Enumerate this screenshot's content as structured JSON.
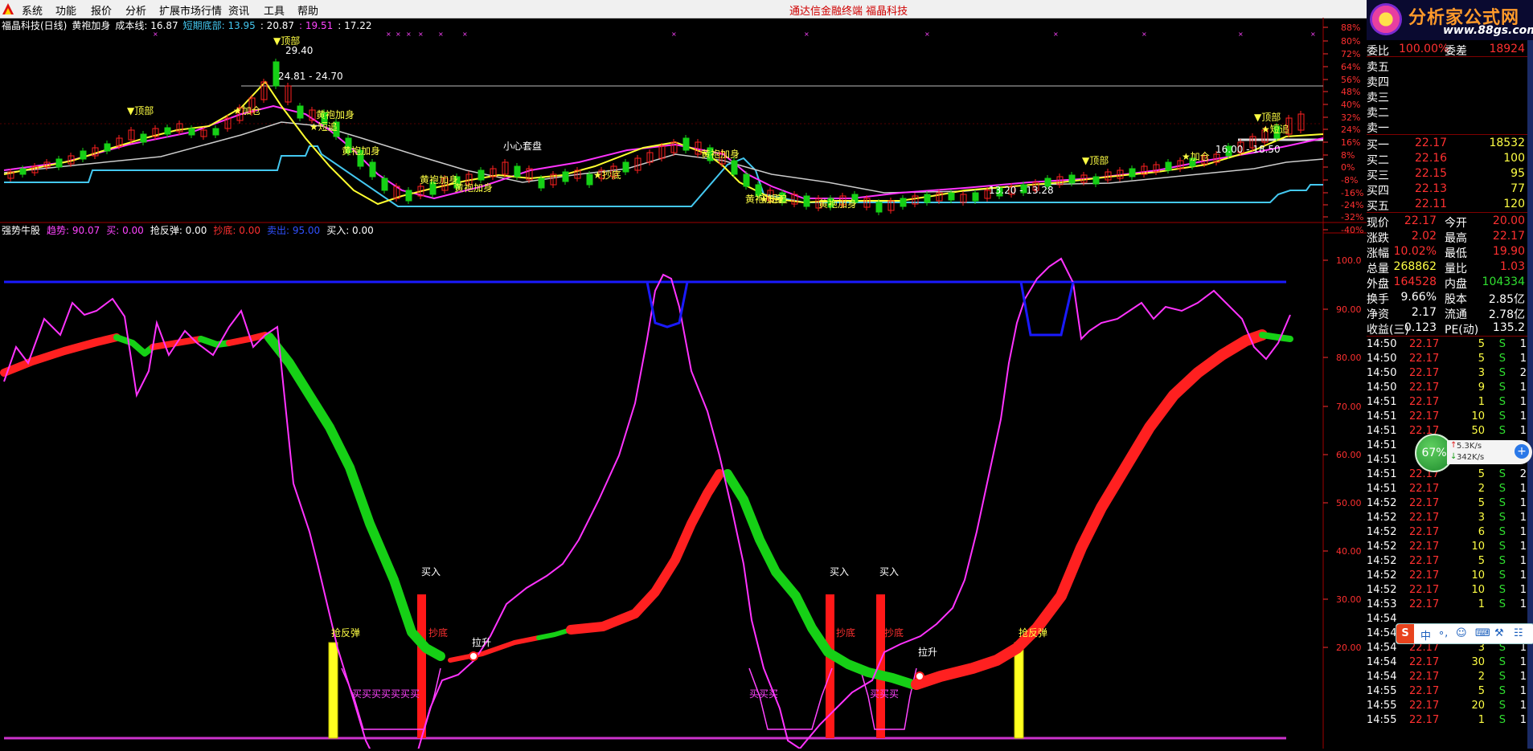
{
  "menu": {
    "items": [
      "系统",
      "功能",
      "报价",
      "分析",
      "扩展市场行情",
      "资讯",
      "工具",
      "帮助"
    ],
    "center_title": "通达信金融终端   福晶科技"
  },
  "top_chart": {
    "title_parts": [
      {
        "text": "福晶科技(日线)",
        "color": "#ffffff"
      },
      {
        "text": "黄袍加身",
        "color": "#ffffff"
      },
      {
        "text": "成本线: 16.87",
        "color": "#ffffff"
      },
      {
        "text": "短期底部: 13.95",
        "color": "#44c8f0"
      },
      {
        "text": ": 20.87",
        "color": "#ffffff"
      },
      {
        "text": ": 19.51",
        "color": "#ff44ff"
      },
      {
        "text": ": 17.22",
        "color": "#ffffff"
      }
    ],
    "y_labels": [
      "88%",
      "80%",
      "72%",
      "64%",
      "56%",
      "48%",
      "40%",
      "32%",
      "24%",
      "16%",
      "8%",
      "0%",
      "-8%",
      "-16%",
      "-24%",
      "-32%",
      "-40%"
    ],
    "annotations": [
      {
        "text": "▼顶部",
        "color": "#ffff44"
      },
      {
        "text": "29.40",
        "color": "#ffffff"
      },
      {
        "text": "24.81 - 24.70",
        "color": "#ffffff"
      },
      {
        "text": "▼顶部",
        "color": "#ffff44"
      },
      {
        "text": "★加仓",
        "color": "#ffff44"
      },
      {
        "text": "黄袍加身",
        "color": "#ffff44"
      },
      {
        "text": "★短追",
        "color": "#ffff44"
      },
      {
        "text": "黄袍加身",
        "color": "#ffff44"
      },
      {
        "text": "小心套盘",
        "color": "#ffffff"
      },
      {
        "text": "黄袍加身",
        "color": "#ffff44"
      },
      {
        "text": "★抄底",
        "color": "#ffff44"
      },
      {
        "text": "黄袍加身",
        "color": "#ffff44"
      },
      {
        "text": "黄袍加身",
        "color": "#ffff44"
      },
      {
        "text": "★短追",
        "color": "#ffff44"
      },
      {
        "text": "黄袍加身",
        "color": "#ffff44"
      },
      {
        "text": "黄袍加身",
        "color": "#ffff44"
      },
      {
        "text": "13.20 - 13.28",
        "color": "#ffffff"
      },
      {
        "text": "▼顶部",
        "color": "#ffff44"
      },
      {
        "text": "★加仓",
        "color": "#ffff44"
      },
      {
        "text": "16.00 - 18.50",
        "color": "#ffffff"
      },
      {
        "text": "▼顶部",
        "color": "#ffff44"
      },
      {
        "text": "★短追",
        "color": "#ffff44"
      }
    ]
  },
  "bottom_chart": {
    "title_parts": [
      {
        "text": "强势牛股",
        "color": "#ffffff"
      },
      {
        "text": "趋势: 90.07",
        "color": "#ff44ff"
      },
      {
        "text": "买: 0.00",
        "color": "#ff44ff"
      },
      {
        "text": "抢反弹: 0.00",
        "color": "#ffffff"
      },
      {
        "text": "抄底: 0.00",
        "color": "#ff3030"
      },
      {
        "text": "卖出: 95.00",
        "color": "#3050ff"
      },
      {
        "text": "买入: 0.00",
        "color": "#ffffff"
      }
    ],
    "y_labels": [
      "100.0",
      "90.00",
      "80.00",
      "70.00",
      "60.00",
      "50.00",
      "40.00",
      "30.00",
      "20.00"
    ],
    "annotations": [
      {
        "text": "买入",
        "color": "#ffffff"
      },
      {
        "text": "买入",
        "color": "#ffffff"
      },
      {
        "text": "买入",
        "color": "#ffffff"
      },
      {
        "text": "抢反弹",
        "color": "#ffff44"
      },
      {
        "text": "抢反弹",
        "color": "#ffff44"
      },
      {
        "text": "抄底",
        "color": "#ff3030"
      },
      {
        "text": "抄底",
        "color": "#ff3030"
      },
      {
        "text": "抄底",
        "color": "#ff3030"
      },
      {
        "text": "拉升",
        "color": "#ffffff"
      },
      {
        "text": "拉升",
        "color": "#ffffff"
      },
      {
        "text": "买买买买买买买",
        "color": "#ff44ff"
      },
      {
        "text": "买买买",
        "color": "#ff44ff"
      },
      {
        "text": "买买买",
        "color": "#ff44ff"
      }
    ]
  },
  "quote": {
    "ad_title": "分析家公式网",
    "ad_url": "www.88gs.com",
    "weibi": {
      "label": "委比",
      "value": "100.00%",
      "label2": "委差",
      "value2": "18924"
    },
    "sell": [
      {
        "label": "卖五",
        "price": "",
        "vol": ""
      },
      {
        "label": "卖四",
        "price": "",
        "vol": ""
      },
      {
        "label": "卖三",
        "price": "",
        "vol": ""
      },
      {
        "label": "卖二",
        "price": "",
        "vol": ""
      },
      {
        "label": "卖一",
        "price": "",
        "vol": ""
      }
    ],
    "buy": [
      {
        "label": "买一",
        "price": "22.17",
        "vol": "18532"
      },
      {
        "label": "买二",
        "price": "22.16",
        "vol": "100"
      },
      {
        "label": "买三",
        "price": "22.15",
        "vol": "95"
      },
      {
        "label": "买四",
        "price": "22.13",
        "vol": "77"
      },
      {
        "label": "买五",
        "price": "22.11",
        "vol": "120"
      }
    ],
    "stats": [
      {
        "l1": "现价",
        "v1": "22.17",
        "c1": "#ff3030",
        "l2": "今开",
        "v2": "20.00",
        "c2": "#ff3030"
      },
      {
        "l1": "涨跌",
        "v1": "2.02",
        "c1": "#ff3030",
        "l2": "最高",
        "v2": "22.17",
        "c2": "#ff3030"
      },
      {
        "l1": "涨幅",
        "v1": "10.02%",
        "c1": "#ff3030",
        "l2": "最低",
        "v2": "19.90",
        "c2": "#ff3030"
      },
      {
        "l1": "总量",
        "v1": "268862",
        "c1": "#ffff44",
        "l2": "量比",
        "v2": "1.03",
        "c2": "#ff3030"
      },
      {
        "l1": "外盘",
        "v1": "164528",
        "c1": "#ff3030",
        "l2": "内盘",
        "v2": "104334",
        "c2": "#30e030"
      },
      {
        "l1": "换手",
        "v1": "9.66%",
        "c1": "#ffffff",
        "l2": "股本",
        "v2": "2.85亿",
        "c2": "#ffffff"
      },
      {
        "l1": "净资",
        "v1": "2.17",
        "c1": "#ffffff",
        "l2": "流通",
        "v2": "2.78亿",
        "c2": "#ffffff"
      },
      {
        "l1": "收益(三)",
        "v1": "0.123",
        "c1": "#ffffff",
        "l2": "PE(动)",
        "v2": "135.2",
        "c2": "#ffffff"
      }
    ],
    "ticks": [
      {
        "t": "14:50",
        "p": "22.17",
        "v": "5",
        "s": "S",
        "n": "1"
      },
      {
        "t": "14:50",
        "p": "22.17",
        "v": "5",
        "s": "S",
        "n": "1"
      },
      {
        "t": "14:50",
        "p": "22.17",
        "v": "3",
        "s": "S",
        "n": "2"
      },
      {
        "t": "14:50",
        "p": "22.17",
        "v": "9",
        "s": "S",
        "n": "1"
      },
      {
        "t": "14:51",
        "p": "22.17",
        "v": "1",
        "s": "S",
        "n": "1"
      },
      {
        "t": "14:51",
        "p": "22.17",
        "v": "10",
        "s": "S",
        "n": "1"
      },
      {
        "t": "14:51",
        "p": "22.17",
        "v": "50",
        "s": "S",
        "n": "1"
      },
      {
        "t": "14:51",
        "p": "",
        "v": "",
        "s": "",
        "n": ""
      },
      {
        "t": "14:51",
        "p": "",
        "v": "",
        "s": "",
        "n": ""
      },
      {
        "t": "14:51",
        "p": "22.17",
        "v": "5",
        "s": "S",
        "n": "2"
      },
      {
        "t": "14:51",
        "p": "22.17",
        "v": "2",
        "s": "S",
        "n": "1"
      },
      {
        "t": "14:52",
        "p": "22.17",
        "v": "5",
        "s": "S",
        "n": "1"
      },
      {
        "t": "14:52",
        "p": "22.17",
        "v": "3",
        "s": "S",
        "n": "1"
      },
      {
        "t": "14:52",
        "p": "22.17",
        "v": "6",
        "s": "S",
        "n": "1"
      },
      {
        "t": "14:52",
        "p": "22.17",
        "v": "10",
        "s": "S",
        "n": "1"
      },
      {
        "t": "14:52",
        "p": "22.17",
        "v": "5",
        "s": "S",
        "n": "1"
      },
      {
        "t": "14:52",
        "p": "22.17",
        "v": "10",
        "s": "S",
        "n": "1"
      },
      {
        "t": "14:52",
        "p": "22.17",
        "v": "10",
        "s": "S",
        "n": "1"
      },
      {
        "t": "14:53",
        "p": "22.17",
        "v": "1",
        "s": "S",
        "n": "1"
      },
      {
        "t": "14:54",
        "p": "",
        "v": "",
        "s": "",
        "n": ""
      },
      {
        "t": "14:54",
        "p": "22.17",
        "v": "10",
        "s": "S",
        "n": "1"
      },
      {
        "t": "14:54",
        "p": "22.17",
        "v": "3",
        "s": "S",
        "n": "1"
      },
      {
        "t": "14:54",
        "p": "22.17",
        "v": "30",
        "s": "S",
        "n": "1"
      },
      {
        "t": "14:54",
        "p": "22.17",
        "v": "2",
        "s": "S",
        "n": "1"
      },
      {
        "t": "14:55",
        "p": "22.17",
        "v": "5",
        "s": "S",
        "n": "1"
      },
      {
        "t": "14:55",
        "p": "22.17",
        "v": "20",
        "s": "S",
        "n": "1"
      },
      {
        "t": "14:55",
        "p": "22.17",
        "v": "1",
        "s": "S",
        "n": "1"
      }
    ]
  },
  "net_widget": {
    "percent": "67%",
    "up": "5.3K/s",
    "down": "342K/s"
  },
  "ime": {
    "s": "S",
    "items": [
      "中",
      "∘,",
      "☺",
      "⌨",
      "⚒",
      "☷"
    ]
  },
  "colors": {
    "red": "#ff2020",
    "green": "#16d016",
    "magenta": "#ff33ff",
    "blue": "#1a1aff",
    "yellow": "#ffff30",
    "cyan": "#44c8f0"
  }
}
